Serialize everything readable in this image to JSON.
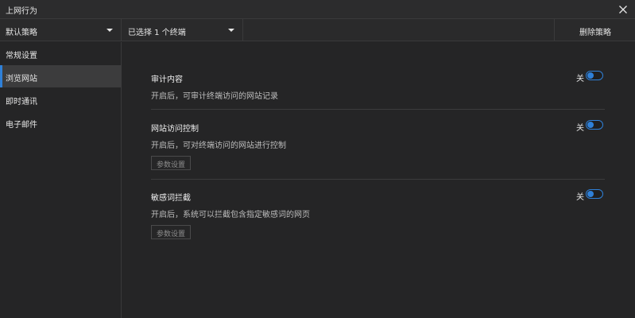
{
  "window": {
    "title": "上网行为"
  },
  "toolbar": {
    "policy_select": "默认策略",
    "terminal_select": "已选择 1 个终端",
    "delete_label": "删除策略"
  },
  "sidebar": {
    "items": [
      {
        "label": "常规设置",
        "active": false
      },
      {
        "label": "浏览网站",
        "active": true
      },
      {
        "label": "即时通讯",
        "active": false
      },
      {
        "label": "电子邮件",
        "active": false
      }
    ]
  },
  "sections": [
    {
      "title": "审计内容",
      "description": "开启后，可审计终端访问的网站记录",
      "toggle_label": "关",
      "enabled": false
    },
    {
      "title": "网站访问控制",
      "description": "开启后，可对终端访问的网站进行控制",
      "toggle_label": "关",
      "enabled": false,
      "button_label": "参数设置"
    },
    {
      "title": "敏感词拦截",
      "description": "开启后，系统可以拦截包含指定敏感词的网页",
      "toggle_label": "关",
      "enabled": false,
      "button_label": "参数设置"
    }
  ],
  "colors": {
    "accent": "#2f80d8",
    "background": "#252526",
    "titlebar": "#2c2c2d"
  },
  "icons": {
    "close": "close-icon",
    "dropdown": "chevron-down-icon"
  }
}
